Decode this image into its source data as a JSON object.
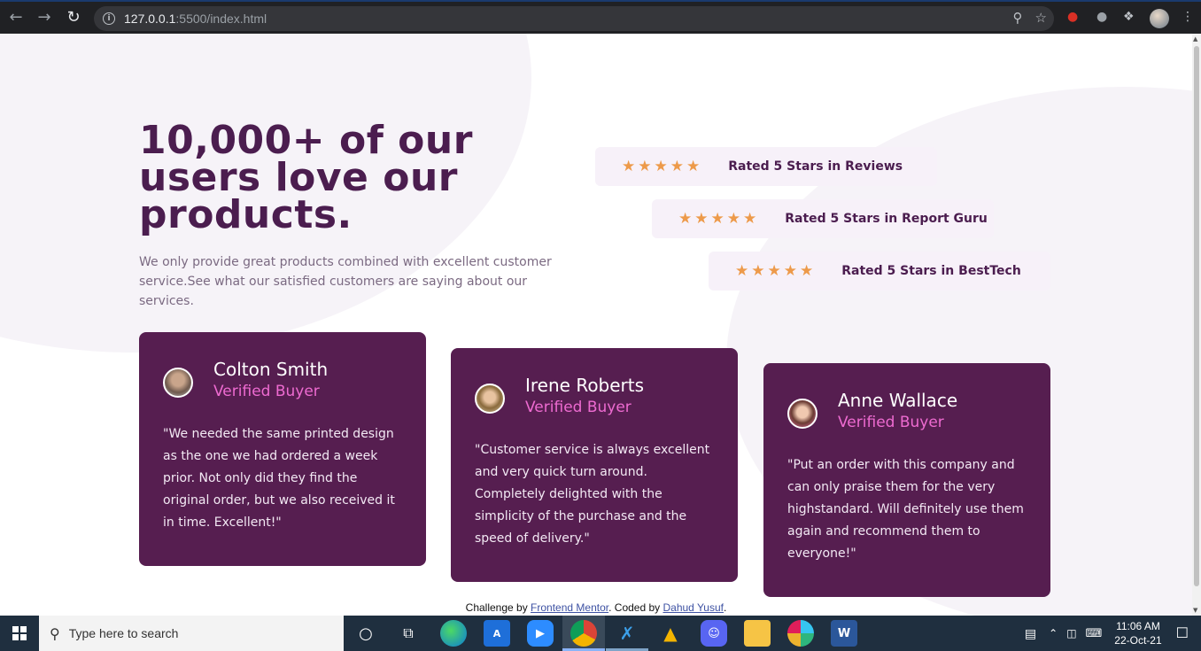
{
  "browser": {
    "url_host": "127.0.0.1",
    "url_rest": ":5500/index.html"
  },
  "hero": {
    "headline": "10,000+ of our users love our products.",
    "intro": "We only provide great products combined with excellent customer service.See what our satisfied customers are saying about our services."
  },
  "ratings": [
    {
      "stars": 5,
      "label": "Rated 5 Stars in Reviews"
    },
    {
      "stars": 5,
      "label": "Rated 5 Stars in Report Guru"
    },
    {
      "stars": 5,
      "label": "Rated 5 Stars in BestTech"
    }
  ],
  "testimonials": [
    {
      "name": "Colton Smith",
      "badge": "Verified Buyer",
      "quote": "\"We needed the same printed design as the one we had ordered a week prior. Not only did they find the original order, but we also received it in time. Excellent!\""
    },
    {
      "name": "Irene Roberts",
      "badge": "Verified Buyer",
      "quote": "\"Customer service is always excellent and very quick turn around. Completely delighted with the simplicity of the purchase and the speed of delivery.\""
    },
    {
      "name": "Anne Wallace",
      "badge": "Verified Buyer",
      "quote": "\"Put an order with this company and can only praise them for the very highstandard. Will definitely use them again and recommend them to everyone!\""
    }
  ],
  "attribution": {
    "prefix": "Challenge by ",
    "link1": "Frontend Mentor",
    "middle": ". Coded by ",
    "link2": "Dahud Yusuf",
    "suffix": "."
  },
  "taskbar": {
    "search_placeholder": "Type here to search",
    "time": "11:06 AM",
    "date": "22-Oct-21"
  },
  "colors": {
    "accent_purple": "#4b1d4f",
    "card_bg": "#561e50",
    "star": "#ed9a4a",
    "verified": "#ee6bd1"
  }
}
